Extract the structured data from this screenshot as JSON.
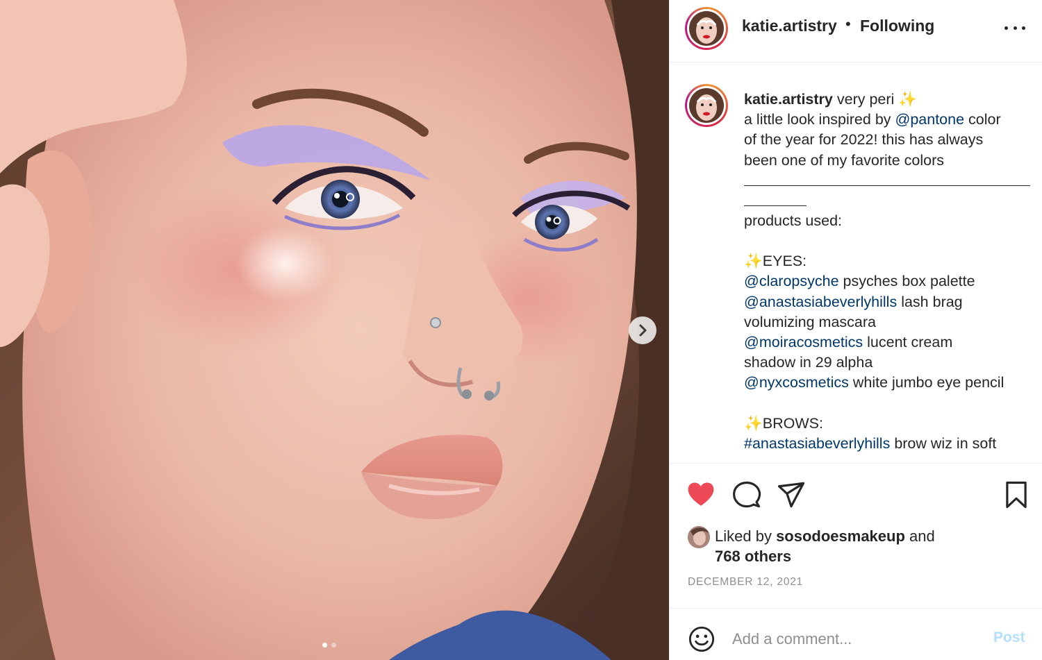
{
  "post": {
    "image_alt": "",
    "carousel": {
      "count": 2,
      "active_index": 0
    }
  },
  "header": {
    "username": "katie.artistry",
    "separator": "•",
    "follow_status": "Following"
  },
  "caption": {
    "username": "katie.artistry",
    "title": "very peri",
    "sparkle": "✨",
    "line1_pre": "a little look inspired by ",
    "line1_mention": "@pantone",
    "line1_post": " color",
    "line2": "of the year for 2022! this has always",
    "line3": "been one of my favorite colors",
    "products_heading": "products used:",
    "eyes_heading": "EYES:",
    "eyes": [
      {
        "mention": "@claropsyche",
        "text": " psyches box palette"
      },
      {
        "mention": "@anastasiabeverlyhills",
        "text": " lash brag"
      },
      {
        "mention": "",
        "text": "volumizing mascara"
      },
      {
        "mention": "@moiracosmetics",
        "text": " lucent cream"
      },
      {
        "mention": "",
        "text": "shadow in 29 alpha"
      },
      {
        "mention": "@nyxcosmetics",
        "text": " white jumbo eye pencil"
      }
    ],
    "brows_heading": "BROWS:",
    "brows": [
      {
        "mention": "#anastasiabeverlyhills",
        "text": " brow wiz in soft"
      }
    ]
  },
  "actions": {
    "liked": true,
    "like_color": "#ed4956"
  },
  "likes": {
    "prefix": "Liked by ",
    "liker": "sosodoesmakeup",
    "and": " and",
    "others": "768 others"
  },
  "date": "DECEMBER 12, 2021",
  "comment": {
    "placeholder": "Add a comment...",
    "post_label": "Post"
  },
  "colors": {
    "mention": "#00376b",
    "post_button_disabled": "#b2dffc",
    "text": "#262626",
    "muted": "#8e8e8e"
  }
}
